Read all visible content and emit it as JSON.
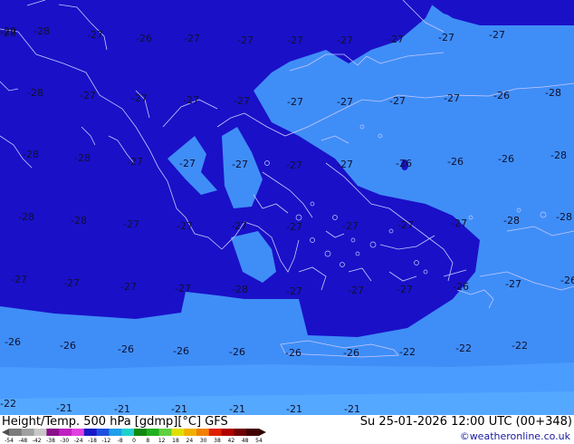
{
  "header": {
    "title": "Height/Temp. 500 hPa [gdmp][°C] GFS",
    "datetime": "Su 25-01-2026 12:00 UTC (00+348)",
    "credit": "©weatheronline.co.uk"
  },
  "colorbar": {
    "ticks": [
      "-54",
      "-48",
      "-42",
      "-38",
      "-30",
      "-24",
      "-18",
      "-12",
      "-8",
      "0",
      "8",
      "12",
      "18",
      "24",
      "30",
      "38",
      "42",
      "48",
      "54"
    ],
    "colors": [
      "#7b7b7b",
      "#a0a0a0",
      "#c8c8c8",
      "#8a0f8a",
      "#c020c0",
      "#e040e0",
      "#1818c8",
      "#1f4fe0",
      "#1fa0e8",
      "#20d0d0",
      "#108810",
      "#20b020",
      "#60d040",
      "#e0e000",
      "#f0b000",
      "#f08000",
      "#e02000",
      "#b00000",
      "#700000",
      "#400000"
    ],
    "arrow_colors": [
      "#505050",
      "#300000"
    ]
  },
  "map_colors": {
    "deep": "#1a10c8",
    "mid": "#3a6cf0",
    "light": "#3f8ef7",
    "coast": "#c8c8ff"
  },
  "temperature_labels": [
    {
      "text": "-29"
    },
    {
      "text": "-28"
    },
    {
      "text": "-27"
    },
    {
      "text": "-26"
    },
    {
      "text": "-27"
    },
    {
      "text": "-27"
    },
    {
      "text": "-27"
    },
    {
      "text": "-27"
    },
    {
      "text": "-27"
    },
    {
      "text": "-27"
    },
    {
      "text": "-27"
    },
    {
      "text": "-28"
    },
    {
      "text": "-28"
    },
    {
      "text": "-27"
    },
    {
      "text": "-27"
    },
    {
      "text": "-27"
    },
    {
      "text": "-27"
    },
    {
      "text": "-27"
    },
    {
      "text": "-27"
    },
    {
      "text": "-27"
    },
    {
      "text": "-27"
    },
    {
      "text": "-26"
    },
    {
      "text": "-28"
    },
    {
      "text": "-28"
    },
    {
      "text": "-28"
    },
    {
      "text": "-27"
    },
    {
      "text": "-27"
    },
    {
      "text": "-27"
    },
    {
      "text": "-27"
    },
    {
      "text": "-27"
    },
    {
      "text": "-26"
    },
    {
      "text": "-26"
    },
    {
      "text": "-26"
    },
    {
      "text": "-28"
    },
    {
      "text": "-28"
    },
    {
      "text": "-28"
    },
    {
      "text": "-27"
    },
    {
      "text": "-27"
    },
    {
      "text": "-27"
    },
    {
      "text": "-27"
    },
    {
      "text": "-27"
    },
    {
      "text": "-27"
    },
    {
      "text": "-27"
    },
    {
      "text": "-28"
    },
    {
      "text": "-28"
    },
    {
      "text": "-27"
    },
    {
      "text": "-27"
    },
    {
      "text": "-27"
    },
    {
      "text": "-27"
    },
    {
      "text": "-28"
    },
    {
      "text": "-27"
    },
    {
      "text": "-27"
    },
    {
      "text": "-27"
    },
    {
      "text": "-26"
    },
    {
      "text": "-27"
    },
    {
      "text": "-26"
    },
    {
      "text": "-26"
    },
    {
      "text": "-26"
    },
    {
      "text": "-26"
    },
    {
      "text": "-26"
    },
    {
      "text": "-26"
    },
    {
      "text": "-26"
    },
    {
      "text": "-26"
    },
    {
      "text": "-22"
    },
    {
      "text": "-22"
    },
    {
      "text": "-22"
    },
    {
      "text": "-22"
    },
    {
      "text": "-21"
    },
    {
      "text": "-21"
    },
    {
      "text": "-21"
    },
    {
      "text": "-21"
    },
    {
      "text": "-21"
    },
    {
      "text": "-21"
    }
  ]
}
